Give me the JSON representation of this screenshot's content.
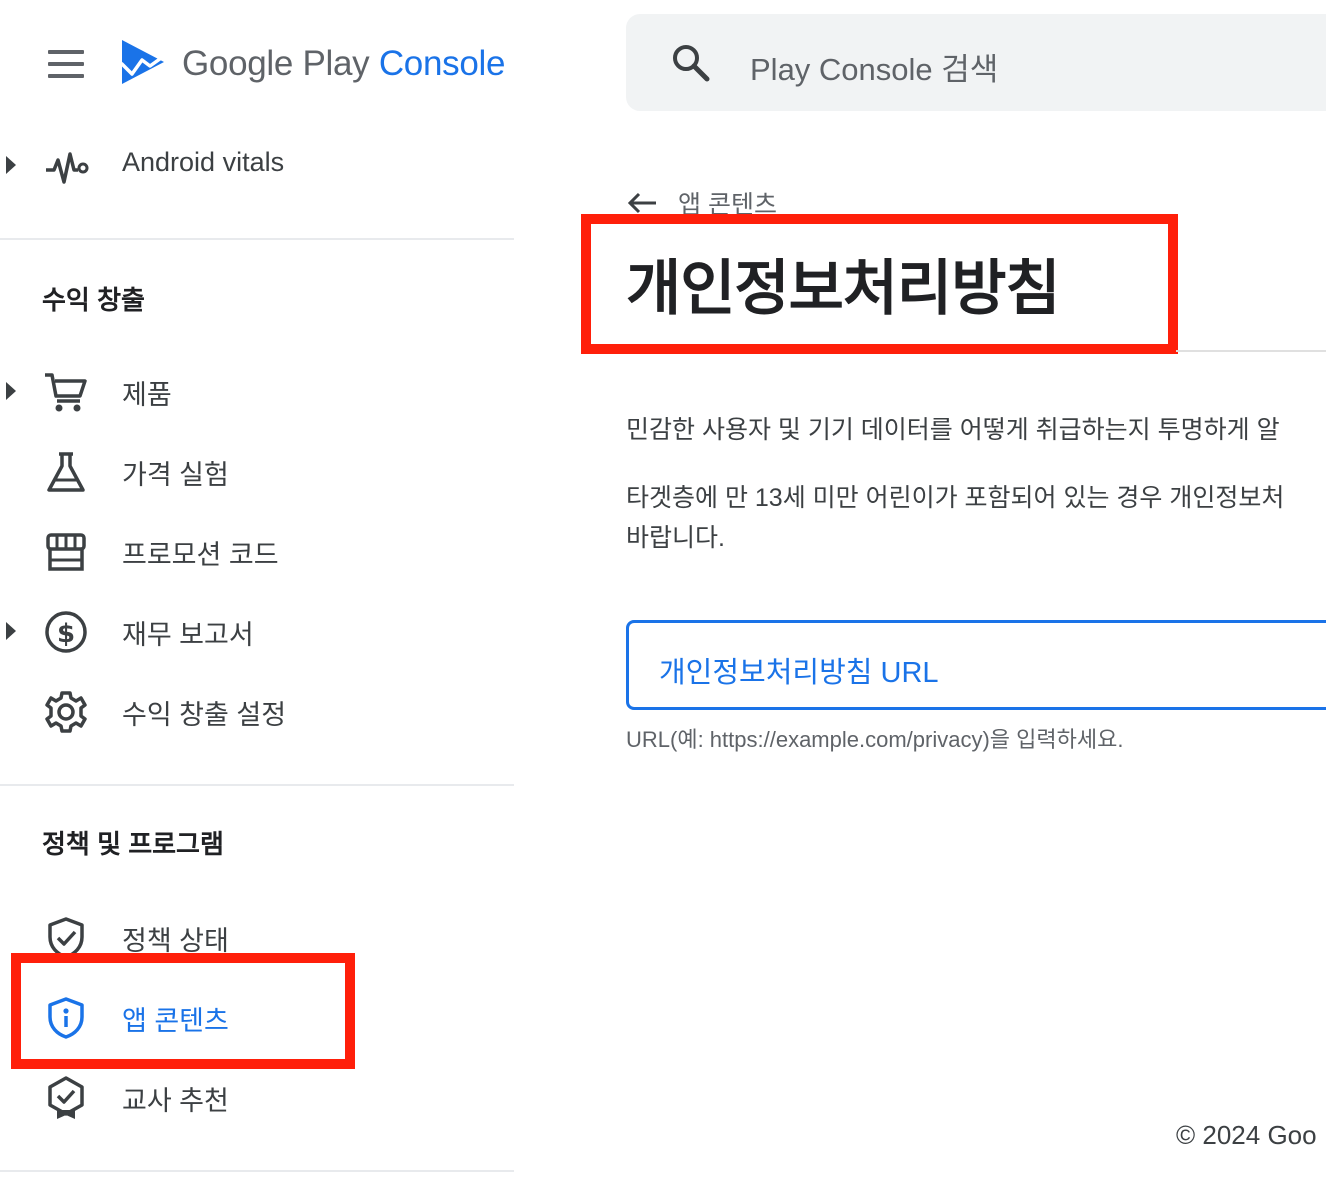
{
  "header": {
    "logo_google_play": "Google Play",
    "logo_console": "Console",
    "search_placeholder": "Play Console 검색"
  },
  "sidebar": {
    "top_items": [
      {
        "label": "Android vitals",
        "icon": "vitals-icon",
        "expandable": true
      }
    ],
    "monetization": {
      "title": "수익 창출",
      "items": [
        {
          "label": "제품",
          "icon": "cart-icon",
          "expandable": true
        },
        {
          "label": "가격 실험",
          "icon": "flask-icon",
          "expandable": false
        },
        {
          "label": "프로모션 코드",
          "icon": "storefront-icon",
          "expandable": false
        },
        {
          "label": "재무 보고서",
          "icon": "dollar-icon",
          "expandable": true
        },
        {
          "label": "수익 창출 설정",
          "icon": "gear-icon",
          "expandable": false
        }
      ]
    },
    "policy": {
      "title": "정책 및 프로그램",
      "items": [
        {
          "label": "정책 상태",
          "icon": "shield-check-icon",
          "active": false
        },
        {
          "label": "앱 콘텐츠",
          "icon": "shield-info-icon",
          "active": true
        },
        {
          "label": "교사 추천",
          "icon": "award-icon",
          "active": false
        }
      ]
    }
  },
  "main": {
    "breadcrumb": "앱 콘텐츠",
    "title": "개인정보처리방침",
    "paragraph1": "민감한 사용자 및 기기 데이터를 어떻게 취급하는지 투명하게 알",
    "paragraph2_line1": "타겟층에 만 13세 미만 어린이가 포함되어 있는 경우 개인정보처",
    "paragraph2_line2": "바랍니다.",
    "url_field_label": "개인정보처리방침 URL",
    "url_helper": "URL(예: https://example.com/privacy)을 입력하세요.",
    "footer": "© 2024 Goo"
  },
  "colors": {
    "accent": "#1a73e8",
    "highlight": "#ff1f0a",
    "text_primary": "#202124",
    "text_secondary": "#5f6368"
  }
}
